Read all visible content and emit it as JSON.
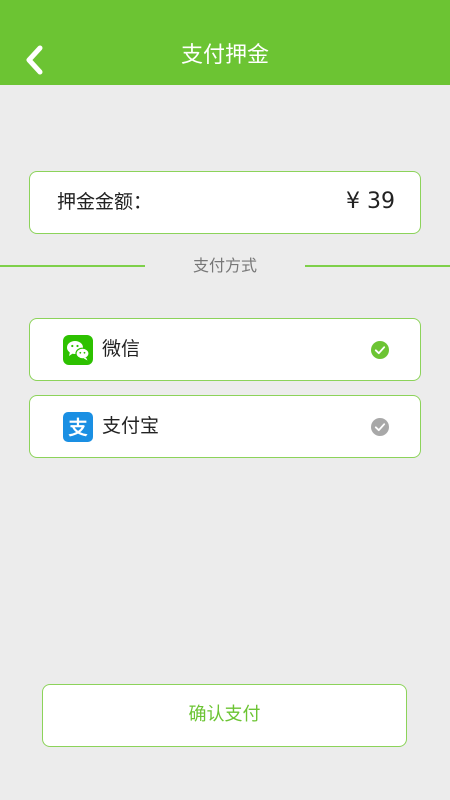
{
  "header": {
    "title": "支付押金",
    "back_icon": "chevron-left-icon",
    "background_color": "#6cc433"
  },
  "deposit": {
    "label": "押金金额：",
    "amount": "¥ 39"
  },
  "payment_section": {
    "divider_label": "支付方式"
  },
  "payment_methods": [
    {
      "label": "微信",
      "icon": "wechat-icon",
      "icon_color": "#2dc100",
      "selected": true,
      "check_color": "#6cc433"
    },
    {
      "label": "支付宝",
      "icon": "alipay-icon",
      "icon_color": "#1a8fe3",
      "selected": false,
      "check_color": "#a8a8a8"
    }
  ],
  "confirm_button": {
    "label": "确认支付"
  },
  "colors": {
    "accent": "#6cc433",
    "border": "#8cd35a",
    "background": "#ececec"
  }
}
